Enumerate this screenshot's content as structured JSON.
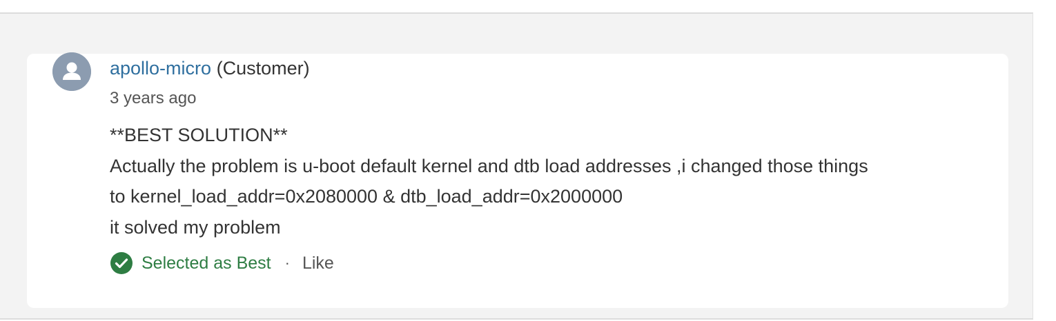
{
  "comment": {
    "author": "apollo-micro",
    "role": "(Customer)",
    "timestamp": "3 years ago",
    "body_lines": [
      "**BEST SOLUTION**",
      "Actually the problem is u-boot default kernel and dtb load addresses ,i changed those things",
      "to kernel_load_addr=0x2080000 & dtb_load_addr=0x2000000",
      "it solved my problem"
    ],
    "selected_label": "Selected as Best",
    "separator": "·",
    "like_label": "Like"
  },
  "icons": {
    "avatar": "user-avatar-icon",
    "best": "check-circle-icon"
  },
  "colors": {
    "author_link": "#2f6f9f",
    "best_green": "#2e7d43",
    "avatar_bg": "#8c9cb0",
    "panel_bg": "#f3f3f3"
  }
}
